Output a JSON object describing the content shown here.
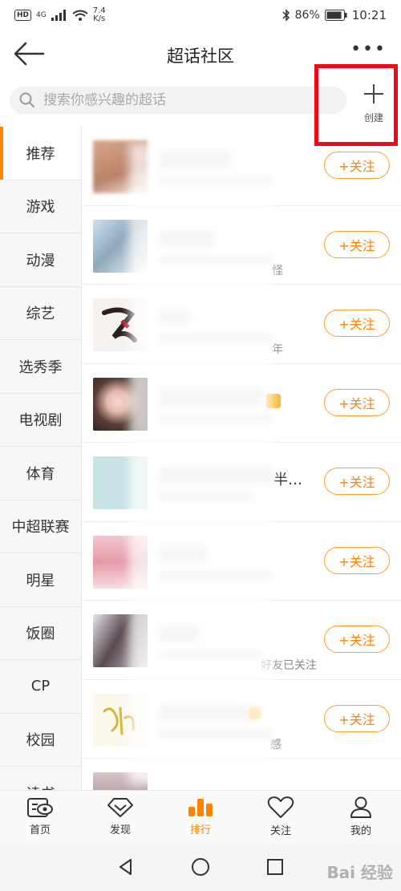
{
  "status_bar": {
    "hd": "HD",
    "signal": "4G",
    "net_speed_value": "7.4",
    "net_speed_unit": "K/s",
    "battery": "86%",
    "time": "10:21"
  },
  "header": {
    "title": "超话社区",
    "more": "•••"
  },
  "search": {
    "placeholder": "搜索你感兴趣的超话"
  },
  "create": {
    "label": "创建"
  },
  "sidebar": {
    "items": [
      {
        "label": "推荐"
      },
      {
        "label": "游戏"
      },
      {
        "label": "动漫"
      },
      {
        "label": "综艺"
      },
      {
        "label": "选秀季"
      },
      {
        "label": "电视剧"
      },
      {
        "label": "体育"
      },
      {
        "label": "中超联赛"
      },
      {
        "label": "明星"
      },
      {
        "label": "饭圈"
      },
      {
        "label": "CP"
      },
      {
        "label": "校园"
      },
      {
        "label": "读书"
      }
    ]
  },
  "list": {
    "follow_label": "+关注",
    "visible_fragments": {
      "row2": "怪",
      "row3": "年",
      "row5": "半…",
      "row7": "好友已关注",
      "row8": "感"
    }
  },
  "tabs": [
    {
      "label": "首页"
    },
    {
      "label": "发现"
    },
    {
      "label": "排行"
    },
    {
      "label": "关注"
    },
    {
      "label": "我的"
    }
  ],
  "watermark": "Bai 经验",
  "colors": {
    "accent": "#ff8200",
    "highlight": "#ea0a1a"
  }
}
